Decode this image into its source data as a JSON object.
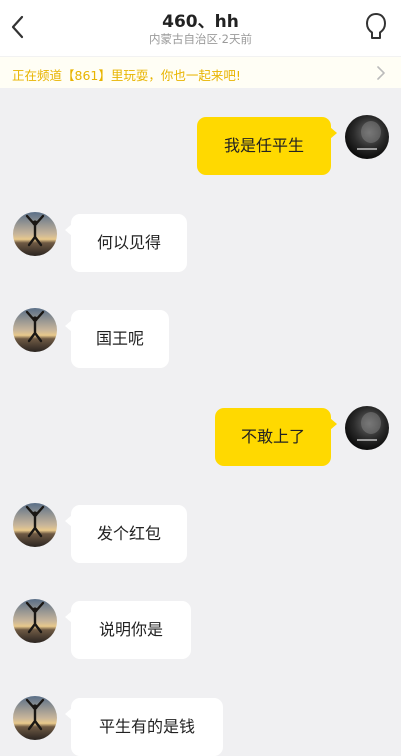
{
  "header": {
    "title": "460、hh",
    "subtitle": "内蒙古自治区·2天前",
    "back_icon": "chevron-left-icon",
    "profile_icon": "person-outline-icon"
  },
  "banner": {
    "text": "正在频道【861】里玩耍，你也一起来吧!",
    "color": "#e8b400",
    "arrow_icon": "chevron-right-icon"
  },
  "messages": [
    {
      "from": "me",
      "text": "我是任平生"
    },
    {
      "from": "other",
      "text": "何以见得"
    },
    {
      "from": "other",
      "text": "国王呢"
    },
    {
      "from": "me",
      "text": "不敢上了"
    },
    {
      "from": "other",
      "text": "发个红包"
    },
    {
      "from": "other",
      "text": "说明你是"
    },
    {
      "from": "other",
      "text": "平生有的是钱"
    }
  ],
  "colors": {
    "outgoing_bubble": "#ffd900",
    "incoming_bubble": "#ffffff",
    "chat_background": "#f0f0f2"
  }
}
